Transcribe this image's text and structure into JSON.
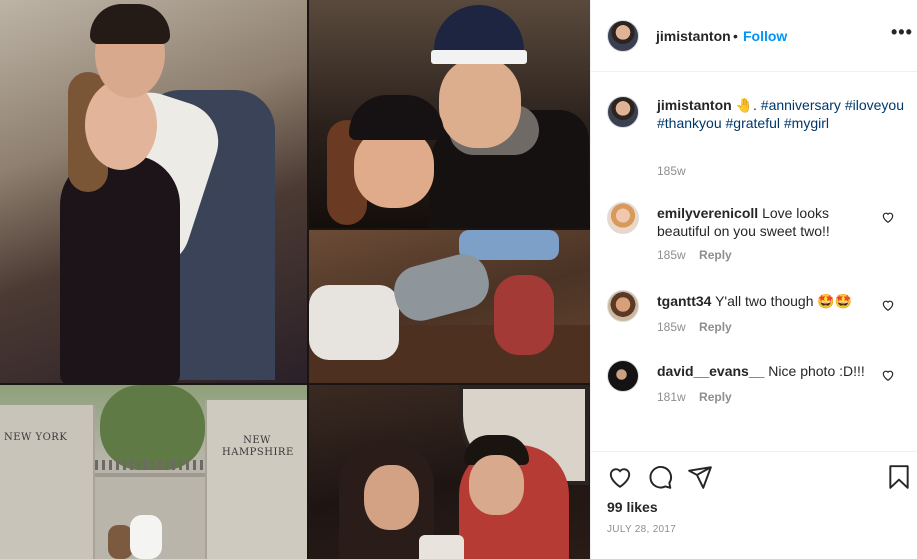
{
  "post": {
    "author": {
      "username": "jimistanton",
      "follow_label": "Follow",
      "separator": "•"
    },
    "more_label": "•••",
    "caption": {
      "username": "jimistanton",
      "emoji": "🤚",
      "punct": ".",
      "hashtags": [
        "#anniversary",
        "#iloveyou",
        "#thankyou",
        "#grateful",
        "#mygirl"
      ],
      "time": "185w"
    },
    "media": {
      "signs": [
        "NEW YORK",
        "NEW HAMPSHIRE"
      ]
    },
    "comments": [
      {
        "username": "emilyverenicoll",
        "text": "Love looks beautiful on you sweet two!!",
        "time": "185w",
        "reply": "Reply"
      },
      {
        "username": "tgantt34",
        "text": "Y'all two though 🤩🤩",
        "time": "185w",
        "reply": "Reply"
      },
      {
        "username": "david__evans__",
        "text": "Nice photo :D!!!",
        "time": "181w",
        "reply": "Reply"
      }
    ],
    "likes": "99 likes",
    "date": "JULY 28, 2017"
  },
  "icons": {
    "like": "heart-outline-icon",
    "comment": "comment-bubble-icon",
    "share": "paper-plane-icon",
    "save": "bookmark-icon",
    "comment_like": "small-heart-icon"
  },
  "colors": {
    "link": "#0095f6",
    "hashtag": "#00376b",
    "muted": "#8e8e8e",
    "text": "#262626"
  }
}
